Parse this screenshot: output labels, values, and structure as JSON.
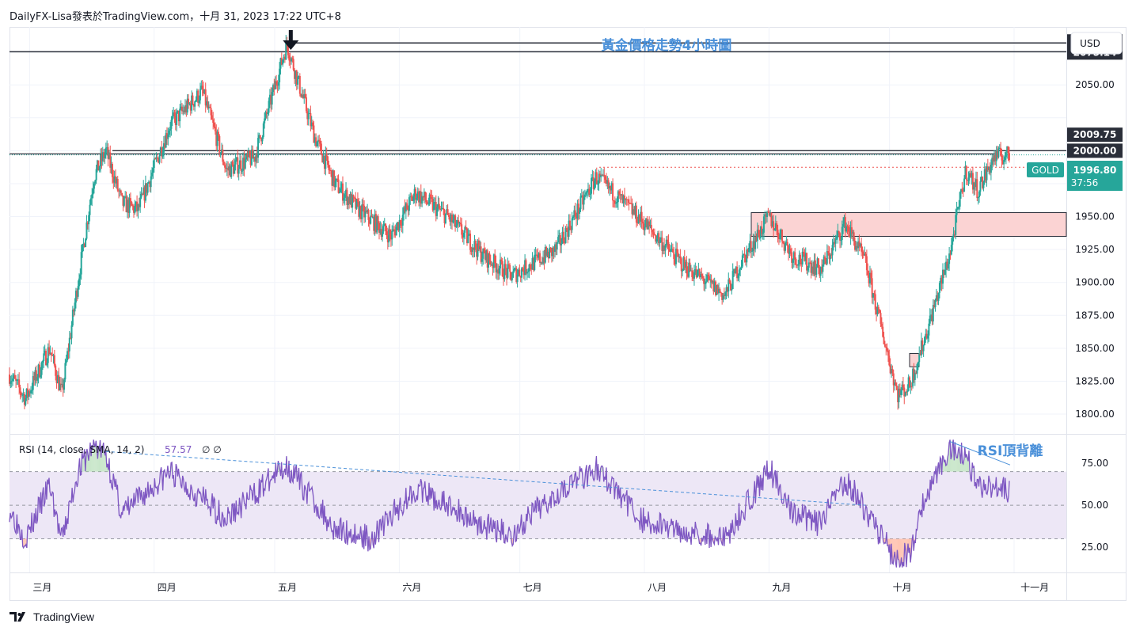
{
  "header": {
    "attribution": "DailyFX-Lisa發表於TradingView.com，十月 31, 2023 17:22 UTC+8"
  },
  "footer": {
    "brand": "TradingView",
    "logo_icon": "tradingview-logo-icon"
  },
  "currency_button": "USD",
  "colors": {
    "up": "#26a69a",
    "down": "#ef5350",
    "rsi_line": "#7e57c2",
    "rsi_band": "#ede7f6",
    "zone_fill": "#fbd3d3",
    "annotation": "#4a90d9",
    "level_line": "#2a2e39",
    "gold_tag": "#26a69a",
    "low_tag": "#f28b8b"
  },
  "chart_data": {
    "type": "candlestick",
    "title": "黃金價格走勢4小時圖",
    "symbol": "GOLD",
    "ylim": [
      1785,
      2094
    ],
    "y_ticks": [
      1800,
      1825,
      1850,
      1875,
      1900,
      1925,
      1950,
      1975,
      2000,
      2025,
      2050,
      2075
    ],
    "y_tick_labels": [
      "1800.00",
      "1825.00",
      "1850.00",
      "1875.00",
      "1900.00",
      "1925.00",
      "1950.00",
      "2000.00",
      "2050.00"
    ],
    "x_labels": [
      "三月",
      "四月",
      "五月",
      "六月",
      "七月",
      "八月",
      "九月",
      "十月",
      "十一月"
    ],
    "price_path": [
      {
        "date": "2023-02-24",
        "price": 1830
      },
      {
        "date": "2023-02-28",
        "price": 1812
      },
      {
        "date": "2023-03-06",
        "price": 1850
      },
      {
        "date": "2023-03-09",
        "price": 1815
      },
      {
        "date": "2023-03-13",
        "price": 1900
      },
      {
        "date": "2023-03-17",
        "price": 1980
      },
      {
        "date": "2023-03-20",
        "price": 2000
      },
      {
        "date": "2023-03-24",
        "price": 1960
      },
      {
        "date": "2023-03-28",
        "price": 1955
      },
      {
        "date": "2023-04-05",
        "price": 2020
      },
      {
        "date": "2023-04-13",
        "price": 2045
      },
      {
        "date": "2023-04-19",
        "price": 1985
      },
      {
        "date": "2023-04-26",
        "price": 1995
      },
      {
        "date": "2023-05-04",
        "price": 2081
      },
      {
        "date": "2023-05-11",
        "price": 2010
      },
      {
        "date": "2023-05-16",
        "price": 1975
      },
      {
        "date": "2023-05-22",
        "price": 1955
      },
      {
        "date": "2023-05-30",
        "price": 1935
      },
      {
        "date": "2023-06-05",
        "price": 1968
      },
      {
        "date": "2023-06-13",
        "price": 1950
      },
      {
        "date": "2023-06-22",
        "price": 1920
      },
      {
        "date": "2023-06-29",
        "price": 1905
      },
      {
        "date": "2023-07-10",
        "price": 1925
      },
      {
        "date": "2023-07-20",
        "price": 1980
      },
      {
        "date": "2023-07-27",
        "price": 1960
      },
      {
        "date": "2023-08-01",
        "price": 1945
      },
      {
        "date": "2023-08-10",
        "price": 1915
      },
      {
        "date": "2023-08-21",
        "price": 1890
      },
      {
        "date": "2023-08-25",
        "price": 1915
      },
      {
        "date": "2023-09-01",
        "price": 1950
      },
      {
        "date": "2023-09-07",
        "price": 1920
      },
      {
        "date": "2023-09-14",
        "price": 1910
      },
      {
        "date": "2023-09-20",
        "price": 1945
      },
      {
        "date": "2023-09-25",
        "price": 1915
      },
      {
        "date": "2023-10-03",
        "price": 1815
      },
      {
        "date": "2023-10-06",
        "price": 1822
      },
      {
        "date": "2023-10-10",
        "price": 1860
      },
      {
        "date": "2023-10-16",
        "price": 1922
      },
      {
        "date": "2023-10-20",
        "price": 1985
      },
      {
        "date": "2023-10-23",
        "price": 1970
      },
      {
        "date": "2023-10-27",
        "price": 1995
      },
      {
        "date": "2023-10-31",
        "price": 1996.8
      }
    ],
    "levels": [
      {
        "price": 2081.82,
        "label": "2081.82",
        "style": "line"
      },
      {
        "price": 2075.14,
        "label": "2075.14",
        "style": "line"
      },
      {
        "price": 2009.75,
        "label": "2009.75",
        "style": "tag"
      },
      {
        "price": 2000.0,
        "label": "2000.00",
        "style": "line"
      },
      {
        "price": 1987.42,
        "label": "1987.42",
        "style": "dotted"
      }
    ],
    "last_price": {
      "symbol": "GOLD",
      "price": "1996.80",
      "countdown": "37:56"
    },
    "zone": {
      "from": 1935,
      "to": 1953
    },
    "rsi": {
      "label": "RSI (14, close, SMA, 14, 2)",
      "value": "57.57",
      "extra": "∅  ∅",
      "levels": [
        70,
        50,
        30
      ],
      "y_ticks": [
        "75.00",
        "50.00",
        "25.00"
      ],
      "ylim": [
        10,
        92
      ],
      "path": [
        {
          "date": "2023-02-24",
          "value": 48
        },
        {
          "date": "2023-02-28",
          "value": 30
        },
        {
          "date": "2023-03-06",
          "value": 62
        },
        {
          "date": "2023-03-09",
          "value": 28
        },
        {
          "date": "2023-03-13",
          "value": 70
        },
        {
          "date": "2023-03-17",
          "value": 86
        },
        {
          "date": "2023-03-20",
          "value": 80
        },
        {
          "date": "2023-03-24",
          "value": 45
        },
        {
          "date": "2023-04-05",
          "value": 70
        },
        {
          "date": "2023-04-19",
          "value": 42
        },
        {
          "date": "2023-05-04",
          "value": 74
        },
        {
          "date": "2023-05-16",
          "value": 36
        },
        {
          "date": "2023-05-25",
          "value": 30
        },
        {
          "date": "2023-06-05",
          "value": 60
        },
        {
          "date": "2023-06-22",
          "value": 38
        },
        {
          "date": "2023-06-29",
          "value": 32
        },
        {
          "date": "2023-07-10",
          "value": 58
        },
        {
          "date": "2023-07-20",
          "value": 72
        },
        {
          "date": "2023-08-01",
          "value": 40
        },
        {
          "date": "2023-08-21",
          "value": 30
        },
        {
          "date": "2023-09-01",
          "value": 72
        },
        {
          "date": "2023-09-07",
          "value": 45
        },
        {
          "date": "2023-09-14",
          "value": 38
        },
        {
          "date": "2023-09-20",
          "value": 66
        },
        {
          "date": "2023-10-03",
          "value": 16
        },
        {
          "date": "2023-10-06",
          "value": 22
        },
        {
          "date": "2023-10-10",
          "value": 55
        },
        {
          "date": "2023-10-16",
          "value": 85
        },
        {
          "date": "2023-10-20",
          "value": 81
        },
        {
          "date": "2023-10-23",
          "value": 60
        },
        {
          "date": "2023-10-27",
          "value": 62
        },
        {
          "date": "2023-10-31",
          "value": 57.57
        }
      ]
    },
    "annotations": [
      {
        "text": "RSI頂背離",
        "type": "label"
      },
      {
        "type": "trendline",
        "from": {
          "date": "2023-03-20",
          "value": 82
        },
        "to": {
          "date": "2023-09-25",
          "value": 50
        }
      },
      {
        "type": "trendline",
        "from": {
          "date": "2023-10-16",
          "value": 88
        },
        "to": {
          "date": "2023-10-31",
          "value": 74
        }
      },
      {
        "type": "arrow-down",
        "date": "2023-05-05"
      }
    ]
  }
}
